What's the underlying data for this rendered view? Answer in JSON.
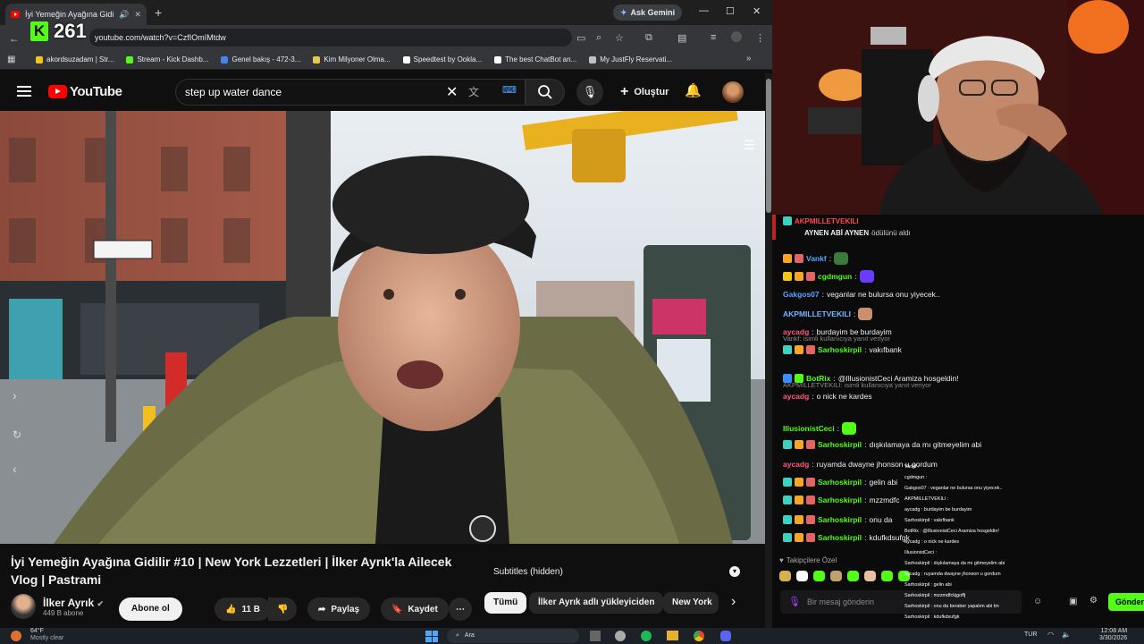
{
  "browser": {
    "tab_title": "İyi Yemeğin Ayağına Gidili",
    "url": "youtube.com/watch?v=CzfIOmIMtdw",
    "gemini_label": "Ask Gemini",
    "kick_count": "261",
    "bookmarks": [
      {
        "label": "akordsuzadam | Str...",
        "color": "#f5c518"
      },
      {
        "label": "Stream - Kick Dashb...",
        "color": "#53fc18"
      },
      {
        "label": "Genel bakış - 472-3...",
        "color": "#4285f4"
      },
      {
        "label": "Kim Milyoner Olma...",
        "color": "#e8c84a"
      },
      {
        "label": "Speedtest by Ookla...",
        "color": "#ffffff"
      },
      {
        "label": "The best ChatBot an...",
        "color": "#ffffff"
      },
      {
        "label": "My JustFly Reservati...",
        "color": "#c0c0c0"
      }
    ]
  },
  "youtube": {
    "logo_text": "YouTube",
    "search_value": "step up water dance",
    "create_label": "Oluştur",
    "video_title": "İyi Yemeğin Ayağına Gidilir #10 | New York Lezzetleri | İlker Ayrık'la Ailecek Vlog | Pastrami",
    "channel_name": "İlker Ayrık",
    "subscriber_count": "449 B abone",
    "subscribe_label": "Abone ol",
    "like_count": "11 B",
    "share_label": "Paylaş",
    "save_label": "Kaydet",
    "subtitles_label": "Subtitles (hidden)",
    "chips": [
      "Tümü",
      "İlker Ayrık adlı yükleyiciden",
      "New York"
    ]
  },
  "chat": {
    "reward": {
      "user": "AKPMILLETVEKILI",
      "text": "AYNEN ABİ AYNEN",
      "suffix": "ödülünü aldı"
    },
    "messages": [
      {
        "user": "Vankf",
        "color": "#5aa2ff",
        "text": "",
        "badges": [
          "#f5a623",
          "#e06666"
        ],
        "emote": "#3a7a3a"
      },
      {
        "user": "cgdmgun",
        "color": "#53fc18",
        "text": "",
        "badges": [
          "#f5c518",
          "#f5a623",
          "#e06666"
        ],
        "emote": "#6a3cff"
      },
      {
        "user": "Gakgos07",
        "color": "#5aa2ff",
        "text": "veganlar ne bulursa onu yiyecek..",
        "badges": []
      },
      {
        "user": "AKPMILLETVEKILI",
        "color": "#7ab4ff",
        "text": "",
        "badges": [],
        "emote": "#c99070"
      },
      {
        "user": "aycadg",
        "color": "#ff5a7a",
        "text": "burdayim be burdayim",
        "badges": []
      },
      {
        "reply": "Vankf: isimli kullanıcıya yanıt veriyor",
        "user": "Sarhoskirpil",
        "color": "#53fc18",
        "text": "vakıfbank",
        "badges": [
          "#3fd0c0",
          "#f5a623",
          "#e06666"
        ]
      },
      {
        "user": "BotRix",
        "color": "#53fc18",
        "text": "@IllusionistCeci Aramiza hosgeldin!",
        "badges": [
          "#3a8fff",
          "#53fc18"
        ]
      },
      {
        "reply": "AKPMILLETVEKILI: isimli kullanıcıya yanıt veriyor",
        "user": "aycadg",
        "color": "#ff5a7a",
        "text": "o nick ne kardes",
        "badges": []
      },
      {
        "user": "IllusionistCeci",
        "color": "#53fc18",
        "text": "",
        "badges": [],
        "emote": "#53fc18"
      },
      {
        "user": "Sarhoskirpil",
        "color": "#53fc18",
        "text": "dışkılamaya da mı gitmeyelim abi",
        "badges": [
          "#3fd0c0",
          "#f5a623",
          "#e06666"
        ]
      },
      {
        "user": "aycadg",
        "color": "#ff5a7a",
        "text": "ruyamda dwayne jhonson u gordum",
        "badges": []
      },
      {
        "user": "Sarhoskirpil",
        "color": "#53fc18",
        "text": "gelin abi",
        "badges": [
          "#3fd0c0",
          "#f5a623",
          "#e06666"
        ]
      },
      {
        "user": "Sarhoskirpil",
        "color": "#53fc18",
        "text": "mzzmdfc",
        "badges": [
          "#3fd0c0",
          "#f5a623",
          "#e06666"
        ]
      },
      {
        "user": "Sarhoskirpil",
        "color": "#53fc18",
        "text": "onu da",
        "badges": [
          "#3fd0c0",
          "#f5a623",
          "#e06666"
        ]
      },
      {
        "user": "Sarhoskirpil",
        "color": "#53fc18",
        "text": "kdufkdsufgk",
        "badges": [
          "#3fd0c0",
          "#f5a623",
          "#e06666"
        ]
      }
    ],
    "followers_label": "Takipçilere Özel",
    "input_placeholder": "Bir mesaj gönderin",
    "send_label": "Gönder",
    "mini_lines": [
      "Vankf :",
      "cgdmgun :",
      "Gakgos07 : veganlar ne bulursa onu yiyecek..",
      "AKPMILLETVEKILI :",
      "aycadg : burdayim be burdayim",
      "Sarhoskirpil : vakıfbank",
      "BotRix : @IllusionistCeci Aramiza hosgeldin!",
      "aycadg : o nick ne kardes",
      "IllusionistCeci :",
      "Sarhoskirpil : dışkılamaya da mı gitmeyelim abi",
      "aycadg : ruyamda dwayne jhonson u gordum",
      "Sarhoskirpil : gelin abi",
      "Sarhoskirpil : mzzmdfckjgoffj",
      "Sarhoskirpil : onu da beraber yapalım abi tm",
      "Sarhoskirpil : kdufkdsufgk"
    ]
  },
  "taskbar": {
    "weather_temp": "64°F",
    "weather_desc": "Mostly clear",
    "search_label": "Ara",
    "lang": "TUR",
    "time": "12:08 AM",
    "date": "3/30/2026"
  },
  "colors": {
    "kick_green": "#53fc18",
    "yt_red": "#ff0000"
  }
}
